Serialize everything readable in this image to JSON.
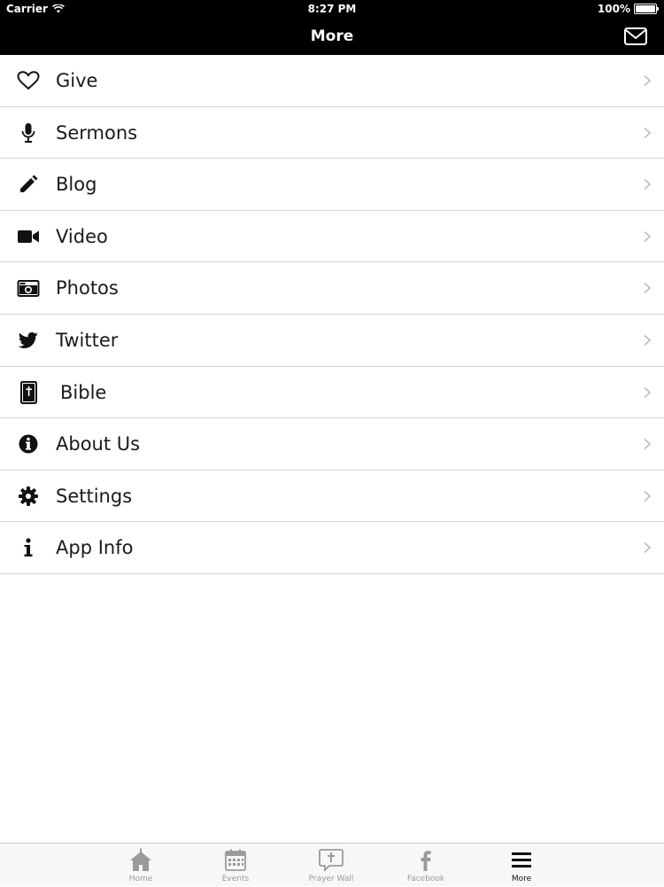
{
  "status_bar": {
    "carrier": "Carrier",
    "time": "8:27 PM",
    "battery": "100%"
  },
  "nav_bar": {
    "title": "More",
    "right_icon": "mail-icon"
  },
  "menu": [
    {
      "label": "Give",
      "icon": "heart-icon"
    },
    {
      "label": "Sermons",
      "icon": "microphone-icon"
    },
    {
      "label": "Blog",
      "icon": "pencil-icon"
    },
    {
      "label": "Video",
      "icon": "video-camera-icon"
    },
    {
      "label": "Photos",
      "icon": "camera-icon"
    },
    {
      "label": "Twitter",
      "icon": "twitter-bird-icon"
    },
    {
      "label": "Bible",
      "icon": "bible-icon"
    },
    {
      "label": "About Us",
      "icon": "info-circle-icon"
    },
    {
      "label": "Settings",
      "icon": "gear-icon"
    },
    {
      "label": "App Info",
      "icon": "info-icon"
    }
  ],
  "tab_bar": {
    "tabs": [
      {
        "label": "Home",
        "icon": "church-icon"
      },
      {
        "label": "Events",
        "icon": "calendar-icon"
      },
      {
        "label": "Prayer Wall",
        "icon": "prayer-bubble-icon"
      },
      {
        "label": "Facebook",
        "icon": "facebook-icon"
      },
      {
        "label": "More",
        "icon": "hamburger-icon"
      }
    ],
    "active": "More"
  },
  "colors": {
    "nav_background": "#000000",
    "tab_active": "#111111",
    "tab_inactive": "#9a9a9a",
    "separator": "#d4d4d4"
  }
}
